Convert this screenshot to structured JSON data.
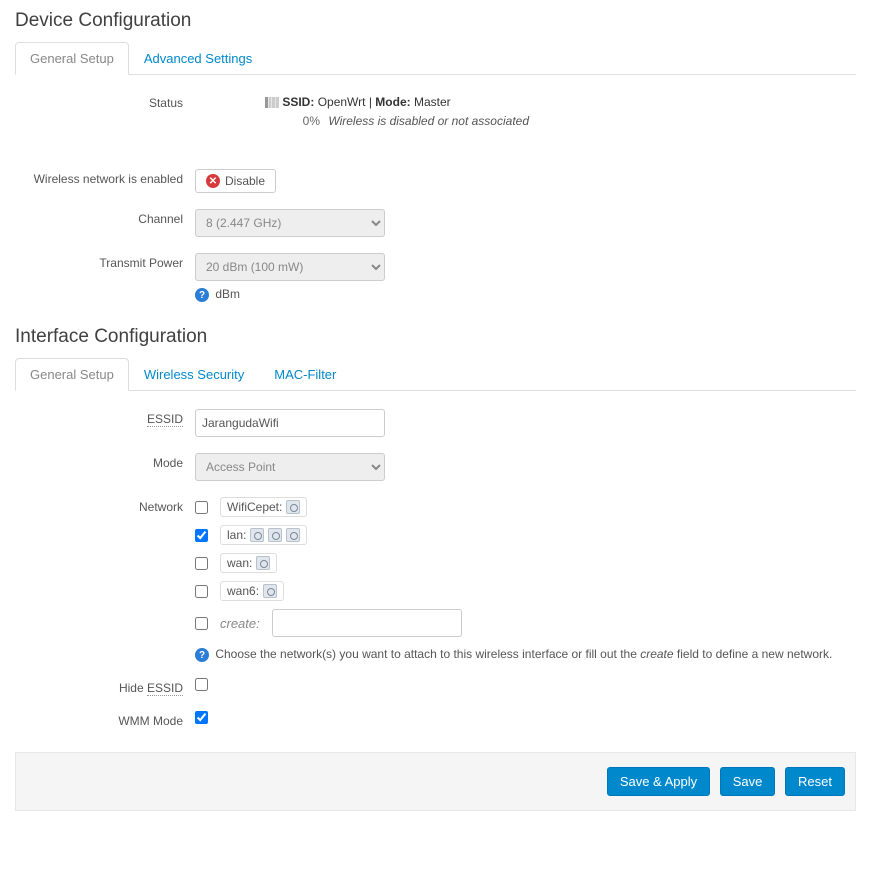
{
  "device": {
    "title": "Device Configuration",
    "tabs": [
      "General Setup",
      "Advanced Settings"
    ],
    "rows": {
      "status_label": "Status",
      "status_percent": "0%",
      "status_ssid_label": "SSID:",
      "status_ssid_value": "OpenWrt",
      "status_mode_label": "Mode:",
      "status_mode_value": "Master",
      "status_line2": "Wireless is disabled or not associated",
      "enabled_label": "Wireless network is enabled",
      "disable_btn": "Disable",
      "channel_label": "Channel",
      "channel_value": "8 (2.447 GHz)",
      "txpower_label": "Transmit Power",
      "txpower_value": "20 dBm (100 mW)",
      "txpower_hint": "dBm"
    }
  },
  "iface": {
    "title": "Interface Configuration",
    "tabs": [
      "General Setup",
      "Wireless Security",
      "MAC-Filter"
    ],
    "rows": {
      "essid_label": "ESSID",
      "essid_value": "JarangudaWifi",
      "mode_label": "Mode",
      "mode_value": "Access Point",
      "network_label": "Network",
      "network_items": [
        {
          "name": "WifiCepet:",
          "checked": false,
          "ifs": 1
        },
        {
          "name": "lan:",
          "checked": true,
          "ifs": 3
        },
        {
          "name": "wan:",
          "checked": false,
          "ifs": 1
        },
        {
          "name": "wan6:",
          "checked": false,
          "ifs": 1
        }
      ],
      "create_label": "create:",
      "network_help_prefix": "Choose the network(s) you want to attach to this wireless interface or fill out the ",
      "network_help_em": "create",
      "network_help_suffix": " field to define a new network.",
      "hide_essid_label": "Hide ESSID",
      "wmm_label": "WMM Mode"
    }
  },
  "footer": {
    "save_apply": "Save & Apply",
    "save": "Save",
    "reset": "Reset"
  }
}
